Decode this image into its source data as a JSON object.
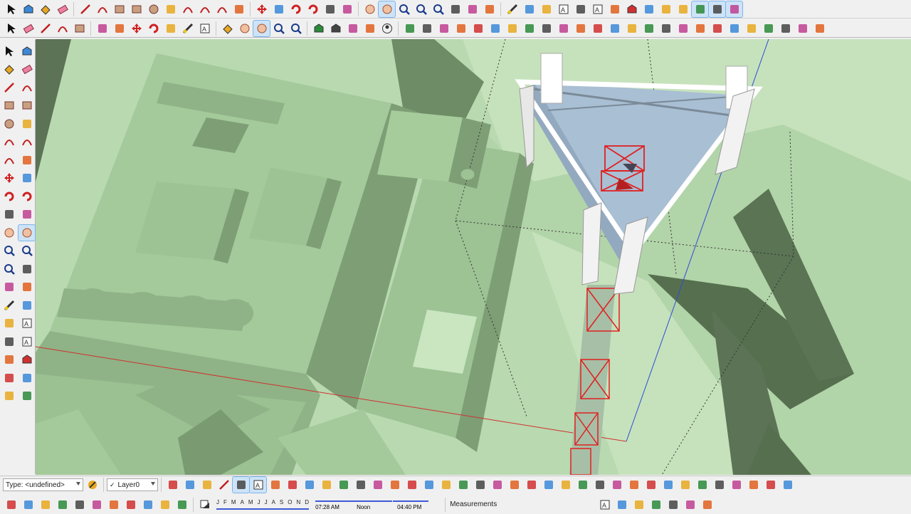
{
  "app": "SketchUp",
  "toolbar_top": {
    "icons": [
      "select-icon",
      "component-icon",
      "paint-bucket-icon",
      "eraser-icon",
      "pencil-line-icon",
      "freehand-icon",
      "rectangle-icon",
      "rotated-rect-icon",
      "circle-icon",
      "polygon-icon",
      "arc-icon",
      "arc-2pt-icon",
      "arc-3pt-icon",
      "pie-icon",
      "move-icon",
      "push-pull-icon",
      "rotate-icon",
      "follow-me-icon",
      "scale-icon",
      "offset-icon",
      "orbit-icon",
      "pan-icon",
      "zoom-icon",
      "zoom-window-icon",
      "zoom-extents-icon",
      "position-camera-icon",
      "look-around-icon",
      "walk-icon",
      "tape-measure-icon",
      "dimension-icon",
      "protractor-icon",
      "text-icon",
      "axes-icon",
      "3d-text-icon",
      "section-plane-icon",
      "warehouse-icon",
      "extension-icon",
      "ruby-icon"
    ]
  },
  "toolbar_second": {
    "icons": [
      "select-icon",
      "eraser-icon",
      "pencil-line-icon",
      "arc-icon",
      "rectangle-icon",
      "push-pull-icon",
      "offset-icon",
      "move-icon",
      "rotate-icon",
      "scale-icon",
      "tape-measure-icon",
      "text-icon",
      "paint-bucket-icon",
      "orbit-icon",
      "pan-icon",
      "zoom-icon",
      "zoom-extents-icon",
      "warehouse-icon",
      "extension-warehouse-icon",
      "layout-icon",
      "ruby-icon",
      "profile-icon"
    ]
  },
  "colors": {
    "viewport_bg": "#b9d9b0",
    "building_top": "#a7cc9c",
    "building_side": "#7a9a72",
    "shadow": "#5c7356",
    "accent": "#3b88d8",
    "tower_selected": "#e02020"
  },
  "bottom": {
    "type_select": "Type: <undefined>",
    "layer_select": "Layer0",
    "check_mark": "✓",
    "months": [
      "J",
      "F",
      "M",
      "A",
      "M",
      "J",
      "J",
      "A",
      "S",
      "O",
      "N",
      "D"
    ],
    "time_start": "07:28 AM",
    "time_noon": "Noon",
    "time_end": "04:40 PM",
    "measurements_label": "Measurements"
  }
}
